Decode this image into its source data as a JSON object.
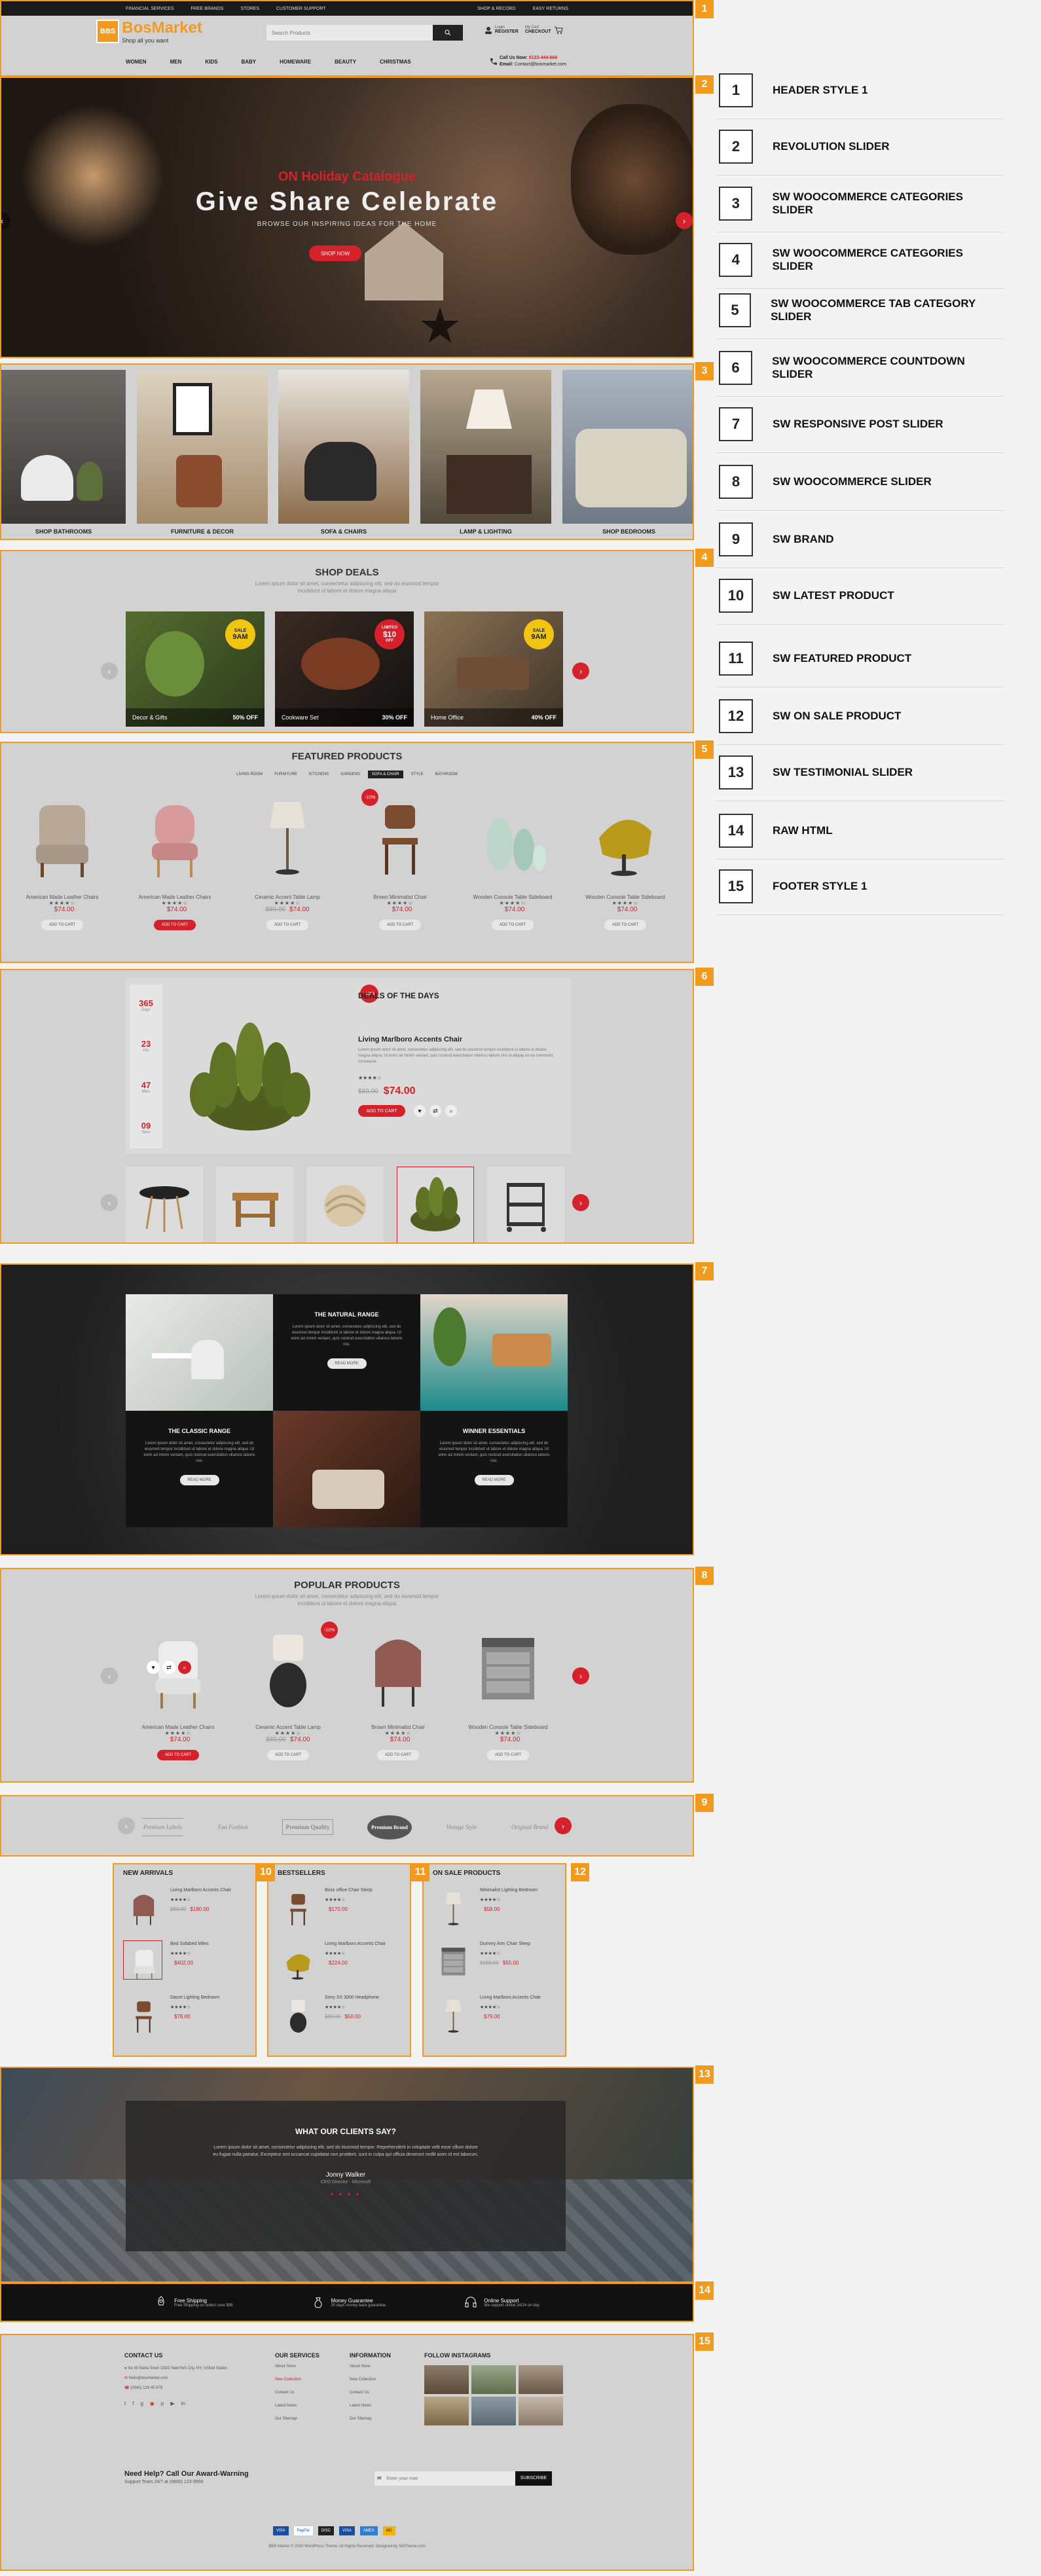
{
  "index": {
    "items": [
      {
        "n": "1",
        "label": "HEADER STYLE 1"
      },
      {
        "n": "2",
        "label": "REVOLUTION SLIDER"
      },
      {
        "n": "3",
        "label": "SW WOOCOMMERCE CATEGORIES SLIDER"
      },
      {
        "n": "4",
        "label": "SW WOOCOMMERCE CATEGORIES SLIDER"
      },
      {
        "n": "5",
        "label": "SW WOOCOMMERCE TAB CATEGORY SLIDER"
      },
      {
        "n": "6",
        "label": "SW WOOCOMMERCE COUNTDOWN SLIDER"
      },
      {
        "n": "7",
        "label": "SW RESPONSIVE POST SLIDER"
      },
      {
        "n": "8",
        "label": "SW WOOCOMMERCE SLIDER"
      },
      {
        "n": "9",
        "label": "SW BRAND"
      },
      {
        "n": "10",
        "label": "SW LATEST PRODUCT"
      },
      {
        "n": "11",
        "label": "SW FEATURED PRODUCT"
      },
      {
        "n": "12",
        "label": "SW ON SALE PRODUCT"
      },
      {
        "n": "13",
        "label": "SW TESTIMONIAL SLIDER"
      },
      {
        "n": "14",
        "label": "RAW HTML"
      },
      {
        "n": "15",
        "label": "FOOTER STYLE 1"
      }
    ]
  },
  "header": {
    "topbar": [
      "FINANCIAL SERVICES",
      "FREE BRANDS",
      "STORES",
      "CUSTOMER SUPPORT"
    ],
    "topbar_right": [
      "SHOP & RECORD",
      "EASY RETURNS"
    ],
    "logo_badge": "BBS",
    "logo_name": "BosMarket",
    "logo_tag": "Shop all you want",
    "search_placeholder": "Search Products",
    "account_small": "Login",
    "account": "REGISTER",
    "cart_small": "My Cart",
    "cart": "CHECKOUT",
    "nav": [
      "WOMEN",
      "MEN",
      "KIDS",
      "BABY",
      "HOMEWARE",
      "BEAUTY",
      "CHRISTMAS"
    ],
    "call_label": "Call Us Now:",
    "phone": "0123-444-666",
    "email_label": "Email:",
    "email": "Contact@bosmarket.com"
  },
  "slider": {
    "kicker": "ON Holiday Catalogue",
    "headline": "Give Share Celebrate",
    "sub": "BROWSE OUR INSPIRING IDEAS FOR THE HOME",
    "button": "SHOP NOW"
  },
  "categories": [
    "SHOP BATHROOMS",
    "FURNITURE & DECOR",
    "SOFA & CHAIRS",
    "LAMP & LIGHTING",
    "SHOP BEDROOMS"
  ],
  "deals": {
    "title": "SHOP DEALS",
    "desc1": "Lorem ipsum dolor sit amet, consectetur adipiscing elit, sed do eiusmod tempor",
    "desc2": "incididunt ut labore et dolore magna aliqua",
    "cards": [
      {
        "name": "Decor & Gifts",
        "off": "50% OFF",
        "badge_a": "SALE",
        "badge_b": "9AM",
        "badge_c": ""
      },
      {
        "name": "Cookware Set",
        "off": "30% OFF",
        "badge_a": "LIMITED",
        "badge_b": "$10",
        "badge_c": "OFF"
      },
      {
        "name": "Home Office",
        "off": "40% OFF",
        "badge_a": "SALE",
        "badge_b": "9AM",
        "badge_c": ""
      }
    ]
  },
  "featured": {
    "title": "FEATURED PRODUCTS",
    "tabs": [
      "LIVING ROOM",
      "FURNITURE",
      "KITCHENS",
      "GARDENS",
      "SOFA & CHAIR",
      "STYLE",
      "BATHROOM"
    ],
    "products": [
      {
        "name": "American Made Leather Chairs",
        "old": "",
        "price": "$74.00",
        "btn": "ADD TO CART"
      },
      {
        "name": "American Made Leather Chairs",
        "old": "",
        "price": "$74.00",
        "btn": "ADD TO CART"
      },
      {
        "name": "Ceramic Accent Table Lamp",
        "old": "$80.00",
        "price": "$74.00",
        "btn": "ADD TO CART"
      },
      {
        "name": "Brown Minimalist Chair",
        "old": "",
        "price": "$74.00",
        "btn": "ADD TO CART"
      },
      {
        "name": "Wooden Console Table Sideboard",
        "old": "",
        "price": "$74.00",
        "btn": "ADD TO CART"
      },
      {
        "name": "Wooden Console Table Sideboard",
        "old": "",
        "price": "$74.00",
        "btn": "ADD TO CART"
      }
    ],
    "sale_badge": "-10%"
  },
  "countdown": {
    "title": "DEALS OF THE DAYS",
    "units": [
      {
        "v": "365",
        "l": "Days"
      },
      {
        "v": "23",
        "l": "Hrs"
      },
      {
        "v": "47",
        "l": "Mins"
      },
      {
        "v": "09",
        "l": "Secs"
      }
    ],
    "product": "Living Marlboro Accents Chair",
    "desc": "Lorem ipsum dolor sit amet, consectetur adipiscing elit, sed do eiusmod tempor incididunt ut labore et dolore magna aliqua. Ut enim ad minim veniam, quis nostrud exercitation ullamco laboris nisi ut aliquip ex ea commodo consequat.",
    "old": "$80.00",
    "price": "$74.00",
    "btn": "ADD TO CART",
    "badge": "-10%"
  },
  "posts": {
    "items": [
      {
        "title": "THE NATURAL RANGE",
        "btn": "READ MORE"
      },
      {
        "title": "THE CLASSIC RANGE",
        "btn": "READ MORE"
      },
      {
        "title": "WINNER ESSENTIALS",
        "btn": "READ MORE"
      }
    ],
    "body": "Lorem ipsum dolor sit amet, consectetur adipiscing elit, sed do eiusmod tempor incididunt ut labore et dolore magna aliqua. Ut enim ad minim veniam, quis nostrud exercitation ullamco laboris nisi."
  },
  "popular": {
    "title": "POPULAR PRODUCTS",
    "desc1": "Lorem ipsum dolor sit amet, consectetur adipiscing elit, sed do eiusmod tempor",
    "desc2": "incididunt ut labore et dolore magna aliqua",
    "products": [
      {
        "name": "American Made Leather Chairs",
        "old": "",
        "price": "$74.00",
        "btn": "ADD TO CART"
      },
      {
        "name": "Ceramic Accent Table Lamp",
        "old": "$80.00",
        "price": "$74.00",
        "btn": "ADD TO CART"
      },
      {
        "name": "Brown Minimalist Chair",
        "old": "",
        "price": "$74.00",
        "btn": "ADD TO CART"
      },
      {
        "name": "Wooden Console Table Sideboard",
        "old": "",
        "price": "$74.00",
        "btn": "ADD TO CART"
      }
    ],
    "badge": "-10%"
  },
  "brands": [
    "Premium Labels",
    "Fun Fashion",
    "Premium Quality",
    "Premium Brand",
    "Vintage Style",
    "Original Brand"
  ],
  "lists": [
    {
      "title": "NEW ARRIVALS",
      "items": [
        {
          "name": "Living Marlboro Accents Chair",
          "old": "$80.00",
          "price": "$180.00"
        },
        {
          "name": "Bed Sofabed Miles",
          "old": "",
          "price": "$402.00"
        },
        {
          "name": "Dacot Lighting Bedroom",
          "old": "",
          "price": "$78.00"
        }
      ]
    },
    {
      "title": "BESTSELLERS",
      "items": [
        {
          "name": "Boss office Chair Sleep",
          "old": "",
          "price": "$170.00"
        },
        {
          "name": "Living Marlboro Accents Chair",
          "old": "",
          "price": "$224.00"
        },
        {
          "name": "Sony SX 3000 Headphone",
          "old": "$80.00",
          "price": "$50.00"
        }
      ]
    },
    {
      "title": "ON SALE PRODUCTS",
      "items": [
        {
          "name": "Minimalist Lighting Bedroom",
          "old": "",
          "price": "$58.00"
        },
        {
          "name": "Dummy Arm Chair Sleep",
          "old": "$180.00",
          "price": "$55.00"
        },
        {
          "name": "Living Marlboro Accents Chair",
          "old": "",
          "price": "$79.00"
        }
      ]
    }
  ],
  "testimonial": {
    "title": "WHAT OUR CLIENTS SAY?",
    "quote": "Lorem ipsum dolor sit amet, consectetur adipiscing elit, sed do eiusmod tempor. Reprehenderit in voluptate velit esse cillum dolore eu fugiat nulla pariatur. Excepteur sint occaecat cupidatat non proident, sunt in culpa qui officia deserunt mollit anim id est laborum.",
    "author": "Jonny Walker",
    "role": "CEO Director - Microsoft"
  },
  "services": [
    {
      "t": "Free Shipping",
      "s": "Free Shipping on orders over $99"
    },
    {
      "t": "Money Guarantee",
      "s": "30 days money back guarantee"
    },
    {
      "t": "Online Support",
      "s": "We support online 24/24 on day"
    }
  ],
  "footer": {
    "contact_title": "CONTACT US",
    "contact": [
      "No 40 Baria Sreet 133/2 NewYork City, NY, United States",
      "hello@bosmarket.com",
      "(0942) 123 45 678"
    ],
    "col2_title": "OUR SERVICES",
    "col2": [
      "About Store",
      "New Collection",
      "Contact Us",
      "Latest News",
      "Our Sitemap"
    ],
    "col3_title": "INFORMATION",
    "col3": [
      "About Store",
      "New Collection",
      "Contact Us",
      "Latest News",
      "Our Sitemap"
    ],
    "insta_title": "FOLLOW INSTAGRAMS",
    "help_title": "Need Help? Call Our Award-Warning",
    "help_sub": "Support Team 24/7 at (0800) 123-9656",
    "newsletter_placeholder": "Enter your mail",
    "subscribe": "SUBSCRIBE",
    "payments": [
      "VISA",
      "PayPal",
      "DISC",
      "VISA",
      "AMEX",
      "MC"
    ],
    "copyright": "BBS Market © 2020 WordPress Theme. All Rights Reserved. Designed by SMTheme.com"
  },
  "colors": {
    "accent": "#f39a1d",
    "red": "#d6202a",
    "dark": "#222222"
  }
}
